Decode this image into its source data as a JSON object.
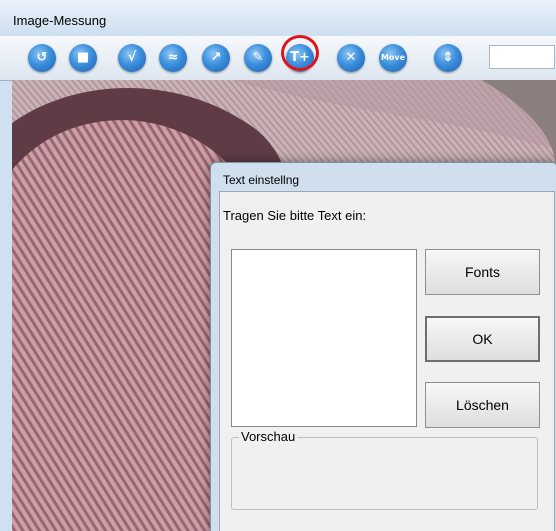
{
  "window": {
    "title": "Image-Messung"
  },
  "toolbar": {
    "buttons": [
      {
        "name": "open-icon",
        "glyph": "↺"
      },
      {
        "name": "save-icon",
        "glyph": "■"
      },
      {
        "name": "measure-icon",
        "glyph": "√"
      },
      {
        "name": "chart-icon",
        "glyph": "≈"
      },
      {
        "name": "draw-icon",
        "glyph": "↗"
      },
      {
        "name": "pen-icon",
        "glyph": "✎"
      },
      {
        "name": "text-icon",
        "glyph": "T+"
      },
      {
        "name": "delete-icon",
        "glyph": "✕"
      },
      {
        "name": "move-icon",
        "glyph": "Move"
      },
      {
        "name": "zoom-icon",
        "glyph": "⇕"
      }
    ]
  },
  "dialog": {
    "title": "Text einstellng",
    "prompt": "Tragen Sie bitte Text ein:",
    "text_value": "",
    "fonts_label": "Fonts",
    "ok_label": "OK",
    "delete_label": "Löschen",
    "preview_label": "Vorschau"
  }
}
